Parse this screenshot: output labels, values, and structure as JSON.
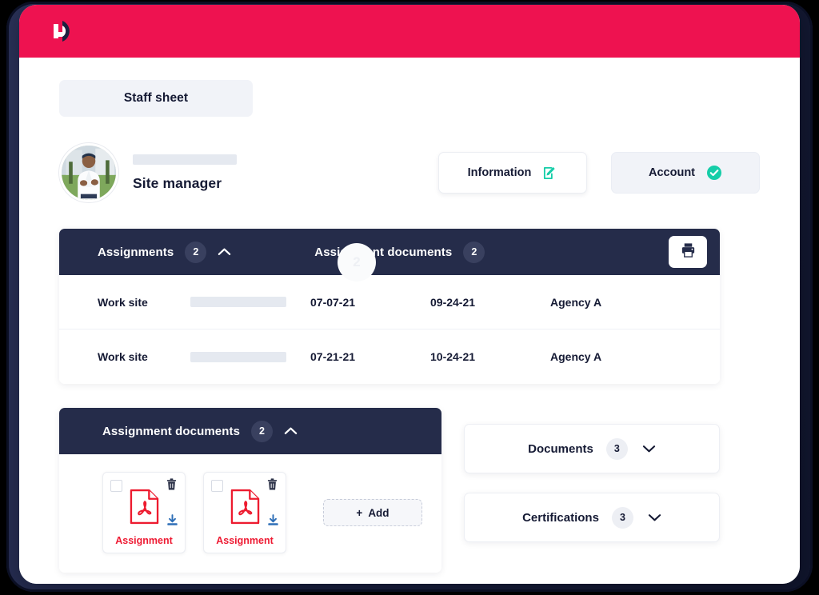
{
  "header": {
    "logo_icon": "d-logo-icon",
    "brand_color": "#EE1250"
  },
  "tabs": {
    "active_label": "Staff sheet"
  },
  "profile": {
    "avatar_icon": "user-photo-avatar",
    "name_redacted": "",
    "role": "Site manager",
    "actions": [
      {
        "label": "Information",
        "icon": "edit-square-icon",
        "icon_color": "#15CDA8",
        "style": "white"
      },
      {
        "label": "Account",
        "icon": "check-circle-icon",
        "icon_color": "#15CDA8",
        "style": "muted"
      }
    ]
  },
  "watermark": {
    "text": "2"
  },
  "assignments": {
    "title": "Assignments",
    "count": "2",
    "chevron": "chevron-up-icon",
    "secondary_title": "Assignment documents",
    "secondary_count": "2",
    "print_icon": "printer-icon",
    "rows": [
      {
        "type": "Work site",
        "redacted": "",
        "start_date": "07-07-21",
        "end_date": "09-24-21",
        "agency": "Agency A"
      },
      {
        "type": "Work site",
        "redacted": "",
        "start_date": "07-21-21",
        "end_date": "10-24-21",
        "agency": "Agency A"
      }
    ]
  },
  "assignment_documents": {
    "title": "Assignment documents",
    "count": "2",
    "chevron": "chevron-up-icon",
    "cards": [
      {
        "label": "Assignment",
        "file_icon": "pdf-file-icon",
        "delete_icon": "trash-icon",
        "download_icon": "download-icon",
        "checkbox": "checkbox-unchecked"
      },
      {
        "label": "Assignment",
        "file_icon": "pdf-file-icon",
        "delete_icon": "trash-icon",
        "download_icon": "download-icon",
        "checkbox": "checkbox-unchecked"
      }
    ],
    "add_label": "Add",
    "add_plus": "+"
  },
  "side_panels": [
    {
      "label": "Documents",
      "count": "3",
      "chevron": "chevron-down-icon"
    },
    {
      "label": "Certifications",
      "count": "3",
      "chevron": "chevron-down-icon"
    }
  ],
  "colors": {
    "brand": "#EE1250",
    "navy": "#252C4A",
    "teal": "#15CDA8",
    "pdf_red": "#EE1B33",
    "download_blue": "#2E6FB7"
  }
}
